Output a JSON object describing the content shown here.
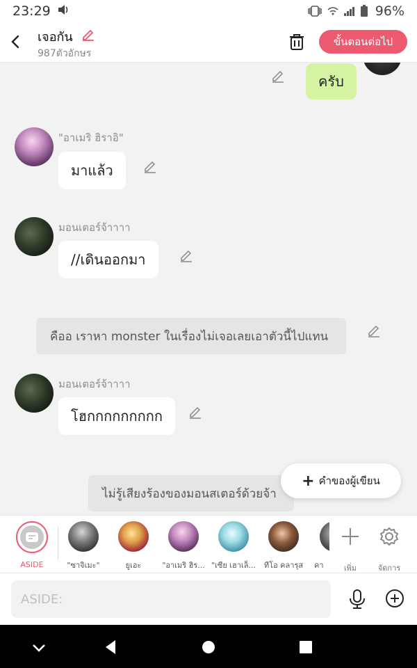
{
  "status_bar": {
    "time": "23:29",
    "battery": "96%"
  },
  "header": {
    "title": "เจอกัน",
    "subtitle": "987ตัวอักษร",
    "next_label": "ขั้นตอนต่อไป"
  },
  "messages": {
    "top_reply": "ครับ",
    "m1": {
      "name": "\"อาเมริ ฮิราอิ\"",
      "text": "มาแล้ว"
    },
    "m2": {
      "name": "มอนเตอร์จ้าาาา",
      "text": "//เดินออกมา"
    },
    "narr1": "คืออ เราหา monster ในเรื่องไม่เจอเลยเอาตัวนี้ไปแทน",
    "m3": {
      "name": "มอนเตอร์จ้าาาา",
      "text": "โฮกกกกกกกกก"
    },
    "narr2": "ไม่รู้เสียงร้องของมอนสเตอร์ด้วยจ้า"
  },
  "author_button": "คำของผู้เขียน",
  "characters": [
    {
      "label": "ASIDE"
    },
    {
      "label": "\"ซาจิเมะ\""
    },
    {
      "label": "ยูเอะ"
    },
    {
      "label": "\"อาเมริ ฮิร..."
    },
    {
      "label": "\"เซีย เฮาเล็..."
    },
    {
      "label": "ทีโอ คลารุส"
    },
    {
      "label": "คา"
    }
  ],
  "tools": {
    "add": "เพิ่ม",
    "manage": "จัดการ"
  },
  "input": {
    "placeholder": "ASIDE:"
  },
  "colors": {
    "accent": "#ec5a6f",
    "my_bubble": "#d6f3a4",
    "chat_bg": "#f2f2f2"
  }
}
